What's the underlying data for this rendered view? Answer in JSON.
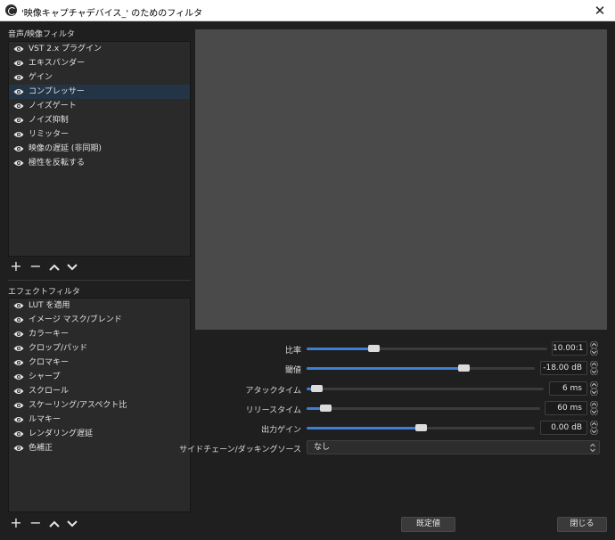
{
  "window": {
    "title": "'映像キャプチャデバイス_' のためのフィルタ",
    "close_glyph": "✕"
  },
  "audio_video_filters": {
    "label": "音声/映像フィルタ",
    "items": [
      {
        "label": "VST 2.x プラグイン",
        "selected": false
      },
      {
        "label": "エキスパンダー",
        "selected": false
      },
      {
        "label": "ゲイン",
        "selected": false
      },
      {
        "label": "コンプレッサー",
        "selected": true
      },
      {
        "label": "ノイズゲート",
        "selected": false
      },
      {
        "label": "ノイズ抑制",
        "selected": false
      },
      {
        "label": "リミッター",
        "selected": false
      },
      {
        "label": "映像の遅延 (非同期)",
        "selected": false
      },
      {
        "label": "極性を反転する",
        "selected": false
      }
    ]
  },
  "effect_filters": {
    "label": "エフェクトフィルタ",
    "items": [
      {
        "label": "LUT を適用"
      },
      {
        "label": "イメージ マスク/ブレンド"
      },
      {
        "label": "カラーキー"
      },
      {
        "label": "クロップ/パッド"
      },
      {
        "label": "クロマキー"
      },
      {
        "label": "シャープ"
      },
      {
        "label": "スクロール"
      },
      {
        "label": "スケーリング/アスペクト比"
      },
      {
        "label": "ルマキー"
      },
      {
        "label": "レンダリング遅延"
      },
      {
        "label": "色補正"
      }
    ]
  },
  "list_buttons": {
    "add": "+",
    "remove": "−"
  },
  "icons": {
    "visibility": "eye-icon",
    "move_up": "chevron-up-icon",
    "move_down": "chevron-down-icon",
    "app": "obs-logo-icon"
  },
  "properties": {
    "ratio": {
      "label": "比率",
      "value": "10.00:1",
      "level": 0.27
    },
    "threshold": {
      "label": "閾値",
      "value": "-18.00 dB",
      "level": 0.7
    },
    "attack": {
      "label": "アタックタイム",
      "value": "6 ms",
      "level": 0.02
    },
    "release": {
      "label": "リリースタイム",
      "value": "60 ms",
      "level": 0.06
    },
    "output_gain": {
      "label": "出力ゲイン",
      "value": "0.00 dB",
      "level": 0.5
    },
    "sidechain": {
      "label": "サイドチェーン/ダッキングソース",
      "value": "なし"
    }
  },
  "buttons": {
    "defaults": "既定値",
    "close": "閉じる"
  },
  "colors": {
    "accent": "#3d7fd4",
    "selection": "#243447",
    "preview_bg": "#4a4a4a",
    "window_bg": "#1f1f1f"
  }
}
